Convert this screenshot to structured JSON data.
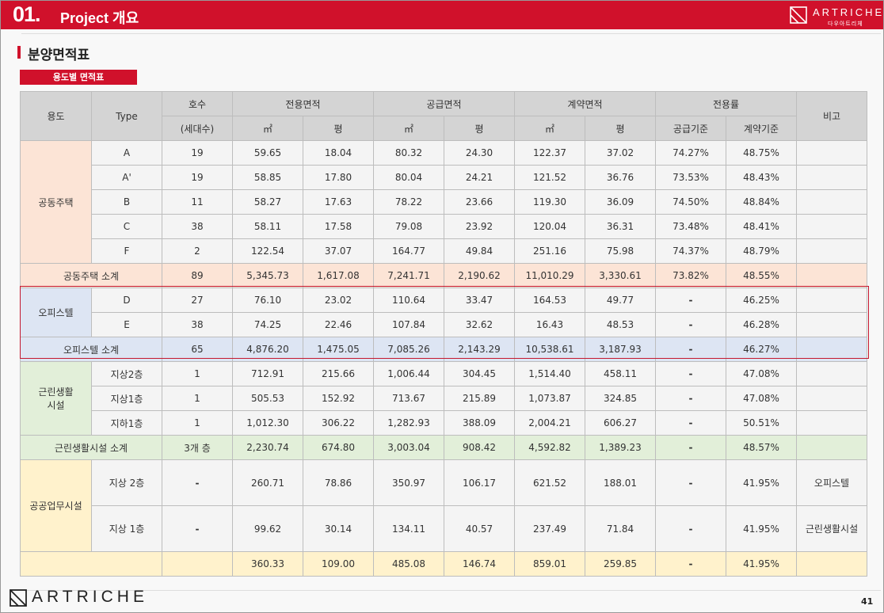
{
  "header": {
    "number": "01",
    "number_dot": ".",
    "title": "Project 개요"
  },
  "brand": {
    "name": "ARTRICHE",
    "sub": "다우아트리체"
  },
  "section": {
    "title": "분양면적표",
    "tag": "용도별 면적표"
  },
  "table": {
    "headers": {
      "use": "용도",
      "type": "Type",
      "units": "호수",
      "units_sub": "(세대수)",
      "exclusive": "전용면적",
      "supply": "공급면적",
      "contract": "계약면적",
      "ratio": "전용률",
      "note": "비고",
      "m2": "㎡",
      "pyeong": "평",
      "supply_basis": "공급기준",
      "contract_basis": "계약기준"
    },
    "groups": {
      "apt": "공동주택",
      "apt_subtotal": "공동주택 소계",
      "office": "오피스텔",
      "office_subtotal": "오피스텔 소계",
      "nb": "근린생활\n시설",
      "nb_subtotal": "근린생활시설 소계",
      "pub": "공공업무시설"
    },
    "apt_rows": [
      [
        "A",
        "19",
        "59.65",
        "18.04",
        "80.32",
        "24.30",
        "122.37",
        "37.02",
        "74.27%",
        "48.75%",
        ""
      ],
      [
        "A'",
        "19",
        "58.85",
        "17.80",
        "80.04",
        "24.21",
        "121.52",
        "36.76",
        "73.53%",
        "48.43%",
        ""
      ],
      [
        "B",
        "11",
        "58.27",
        "17.63",
        "78.22",
        "23.66",
        "119.30",
        "36.09",
        "74.50%",
        "48.84%",
        ""
      ],
      [
        "C",
        "38",
        "58.11",
        "17.58",
        "79.08",
        "23.92",
        "120.04",
        "36.31",
        "73.48%",
        "48.41%",
        ""
      ],
      [
        "F",
        "2",
        "122.54",
        "37.07",
        "164.77",
        "49.84",
        "251.16",
        "75.98",
        "74.37%",
        "48.79%",
        ""
      ]
    ],
    "apt_subtotal": [
      "89",
      "5,345.73",
      "1,617.08",
      "7,241.71",
      "2,190.62",
      "11,010.29",
      "3,330.61",
      "73.82%",
      "48.55%",
      ""
    ],
    "office_rows": [
      [
        "D",
        "27",
        "76.10",
        "23.02",
        "110.64",
        "33.47",
        "164.53",
        "49.77",
        "-",
        "46.25%",
        ""
      ],
      [
        "E",
        "38",
        "74.25",
        "22.46",
        "107.84",
        "32.62",
        "16.43",
        "48.53",
        "-",
        "46.28%",
        ""
      ]
    ],
    "office_subtotal": [
      "65",
      "4,876.20",
      "1,475.05",
      "7,085.26",
      "2,143.29",
      "10,538.61",
      "3,187.93",
      "-",
      "46.27%",
      ""
    ],
    "nb_rows": [
      [
        "지상2층",
        "1",
        "712.91",
        "215.66",
        "1,006.44",
        "304.45",
        "1,514.40",
        "458.11",
        "-",
        "47.08%",
        ""
      ],
      [
        "지상1층",
        "1",
        "505.53",
        "152.92",
        "713.67",
        "215.89",
        "1,073.87",
        "324.85",
        "-",
        "47.08%",
        ""
      ],
      [
        "지하1층",
        "1",
        "1,012.30",
        "306.22",
        "1,282.93",
        "388.09",
        "2,004.21",
        "606.27",
        "-",
        "50.51%",
        ""
      ]
    ],
    "nb_subtotal": [
      "3개 층",
      "2,230.74",
      "674.80",
      "3,003.04",
      "908.42",
      "4,592.82",
      "1,389.23",
      "-",
      "48.57%",
      ""
    ],
    "pub_rows": [
      [
        "지상 2층",
        "-",
        "260.71",
        "78.86",
        "350.97",
        "106.17",
        "621.52",
        "188.01",
        "-",
        "41.95%",
        "오피스텔"
      ],
      [
        "지상 1층",
        "-",
        "99.62",
        "30.14",
        "134.11",
        "40.57",
        "237.49",
        "71.84",
        "-",
        "41.95%",
        "근린생활시설"
      ]
    ],
    "pub_subtotal": [
      "",
      "360.33",
      "109.00",
      "485.08",
      "146.74",
      "859.01",
      "259.85",
      "-",
      "41.95%",
      ""
    ]
  },
  "footer": {
    "page": "41"
  }
}
